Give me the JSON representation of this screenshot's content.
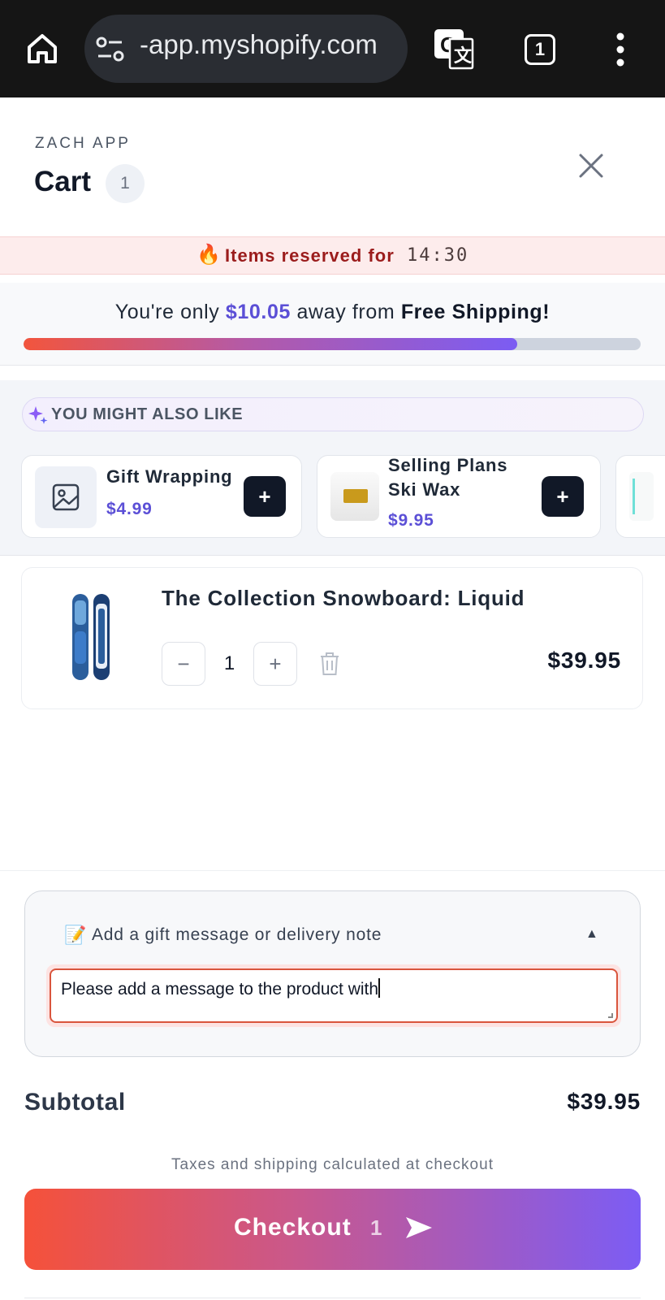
{
  "browser": {
    "url": "-app.myshopify.com",
    "tab_count": "1"
  },
  "header": {
    "store_name": "ZACH APP",
    "title": "Cart",
    "item_count": "1"
  },
  "reservation": {
    "flame": "🔥",
    "label": "Items reserved for",
    "timer": "14:30"
  },
  "shipping": {
    "prefix": "You're only ",
    "amount": "$10.05",
    "middle": " away from ",
    "goal": "Free Shipping!",
    "progress_fraction": 0.8
  },
  "upsell": {
    "label": "YOU MIGHT ALSO LIKE",
    "items": [
      {
        "name": "Gift Wrapping",
        "price": "$4.99",
        "add_label": "+"
      },
      {
        "name": "Selling Plans Ski Wax",
        "price": "$9.95",
        "add_label": "+"
      }
    ]
  },
  "line_item": {
    "title": "The Collection Snowboard: Liquid",
    "minus_label": "−",
    "quantity": "1",
    "plus_label": "+",
    "price": "$39.95"
  },
  "note": {
    "emoji": "📝",
    "label": "Add a gift message or delivery note",
    "toggle": "▲",
    "value": "Please add a message to the product with"
  },
  "summary": {
    "subtotal_label": "Subtotal",
    "subtotal_value": "$39.95",
    "tax_note": "Taxes and shipping calculated at checkout"
  },
  "checkout": {
    "label": "Checkout",
    "count": "1"
  },
  "colors": {
    "accent_purple": "#5b4fd6",
    "checkout_start": "#f5513a",
    "checkout_end": "#7c5cf4",
    "reserve_text": "#9b1c1c",
    "dark_button": "#111827"
  }
}
